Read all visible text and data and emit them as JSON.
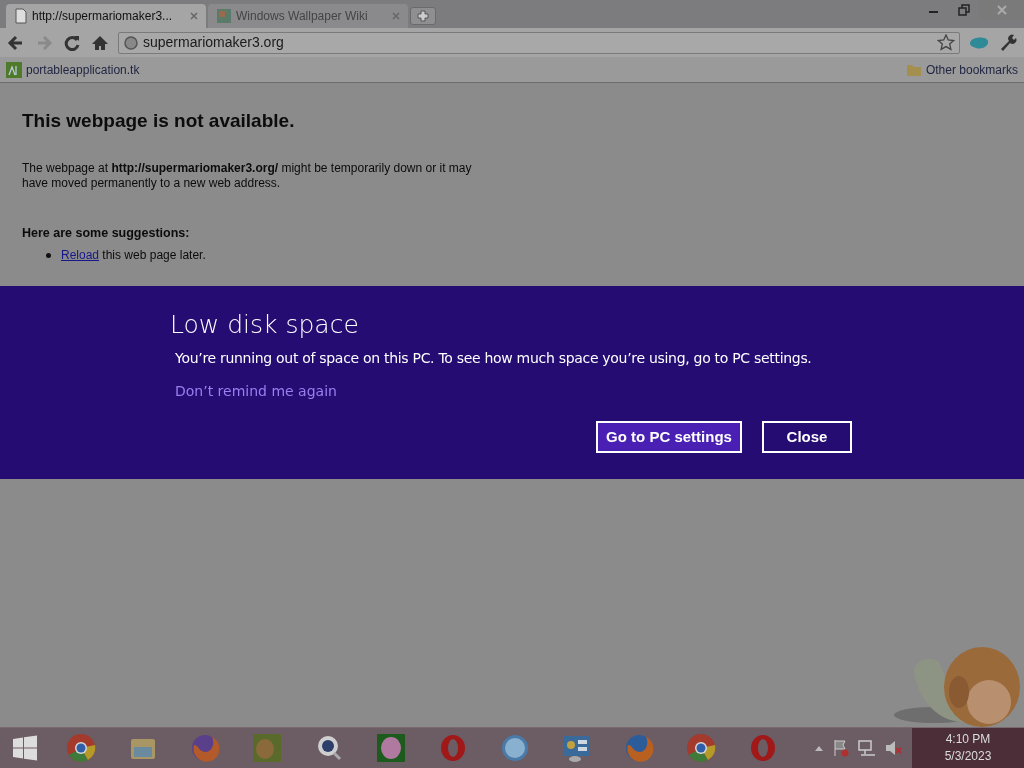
{
  "browser": {
    "tabs": [
      {
        "title": "http://supermariomaker3...",
        "selected": true
      },
      {
        "title": "Windows Wallpaper Wiki",
        "selected": false
      }
    ],
    "address": "supermariomaker3.org",
    "bookmarks": [
      {
        "label": "portableapplication.tk"
      }
    ],
    "other_bookmarks": "Other bookmarks"
  },
  "page": {
    "heading": "This webpage is not available.",
    "message": "The webpage at **http://supermariomaker3.org/** might be temporarily down or it may have moved permanently to a new web address.",
    "suggestions_heading": "Here are some suggestions:",
    "suggestions": [
      {
        "link": "Reload",
        "text": " this web page later."
      }
    ]
  },
  "dialog": {
    "title": "Low disk space",
    "message": "You’re running out of space on this PC. To see how much space you’re using, go to PC settings.",
    "link": "Don’t remind me again",
    "buttons": [
      {
        "label": "Go to PC settings",
        "kind": "primary"
      },
      {
        "label": "Close",
        "kind": "secondary"
      }
    ]
  },
  "taskbar": {
    "time": "4:10 PM",
    "date": "5/3/2023"
  }
}
